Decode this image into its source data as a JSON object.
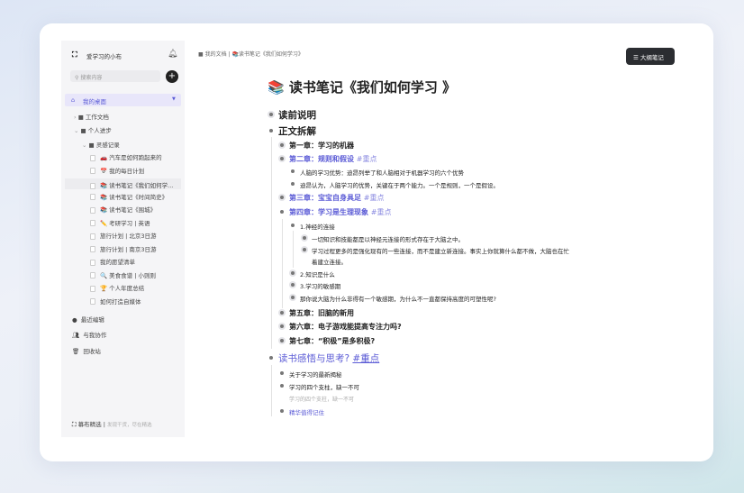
{
  "sidebar": {
    "workspace": "爱学习的小布",
    "search_placeholder": "搜索内容",
    "desktop": "我的桌面",
    "folders": [
      "工作文档",
      "个人进步",
      "灵感记录"
    ],
    "docs": [
      "🚗 汽车是如何跑起来的",
      "📅 我的每日计划",
      "📚 读书笔记《我们如何学...",
      "📚 读书笔记《时间简史》",
      "📚 读书笔记《围城》",
      "✏️ 考研学习 | 英语",
      "旅行计划 | 北京3日游",
      "旅行计划 | 南京3日游",
      "我的愿望清单",
      "🔍 美食食谱 | 小则则",
      "🏆 个人年度总结",
      "如何打造自媒体"
    ],
    "recent": "最近编辑",
    "collab": "与我协作",
    "trash": "回收站",
    "footer_brand": "幕布精选",
    "footer_sub": "发现干货，尽在精选"
  },
  "header": {
    "breadcrumb_root": "我的文档",
    "breadcrumb_current": "📚读书笔记《我们如何学习》",
    "outline_button": "大纲笔记"
  },
  "doc": {
    "title": "📚 读书笔记《我们如何学习 》",
    "rows": [
      {
        "t": "读前说明"
      },
      {
        "t": "正文拆解"
      },
      {
        "t": "第一章：学习的机器"
      },
      {
        "t": "第二章：规则和假设",
        "tag": "#重点"
      },
      {
        "t": "人脑的学习优势：迪昂列举了和人脑相对于机器学习的六个优势"
      },
      {
        "t": "迪昂认为，人脑学习的优势，关键在于两个能力。一个是规则，一个是假设。"
      },
      {
        "t": "第三章：宝宝自身具足",
        "tag": "#重点"
      },
      {
        "t": "第四章：学习是生理现象",
        "tag": "#重点"
      },
      {
        "t": "1.神经的连接"
      },
      {
        "t": "一切知识和技能都是以神经元连接的形式存在于大脑之中。"
      },
      {
        "t": "学习过程更多的是强化现有的一些连接，而不是建立新连接。事实上你就算什么都不做，大脑也在忙"
      },
      {
        "t": "着建立连接。"
      },
      {
        "t": "2.知识是什么"
      },
      {
        "t": "3.学习的敏感期"
      },
      {
        "t": "那你说大脑为什么非得有一个敏感期，为什么不一直都保持高度的可塑性呢?"
      },
      {
        "t": "第五章：旧脑的新用"
      },
      {
        "t": "第六章：电子游戏能提高专注力吗?"
      },
      {
        "t": "第七章：“积极”是多积极?"
      },
      {
        "t": "读书感悟与思考?",
        "tag": "#重点"
      },
      {
        "t": "关于学习的最新揭秘"
      },
      {
        "t": "学习的四个支柱，缺一不可"
      },
      {
        "t": "学习的四个支柱，缺一不可"
      },
      {
        "t": "精华值得记住"
      }
    ]
  }
}
